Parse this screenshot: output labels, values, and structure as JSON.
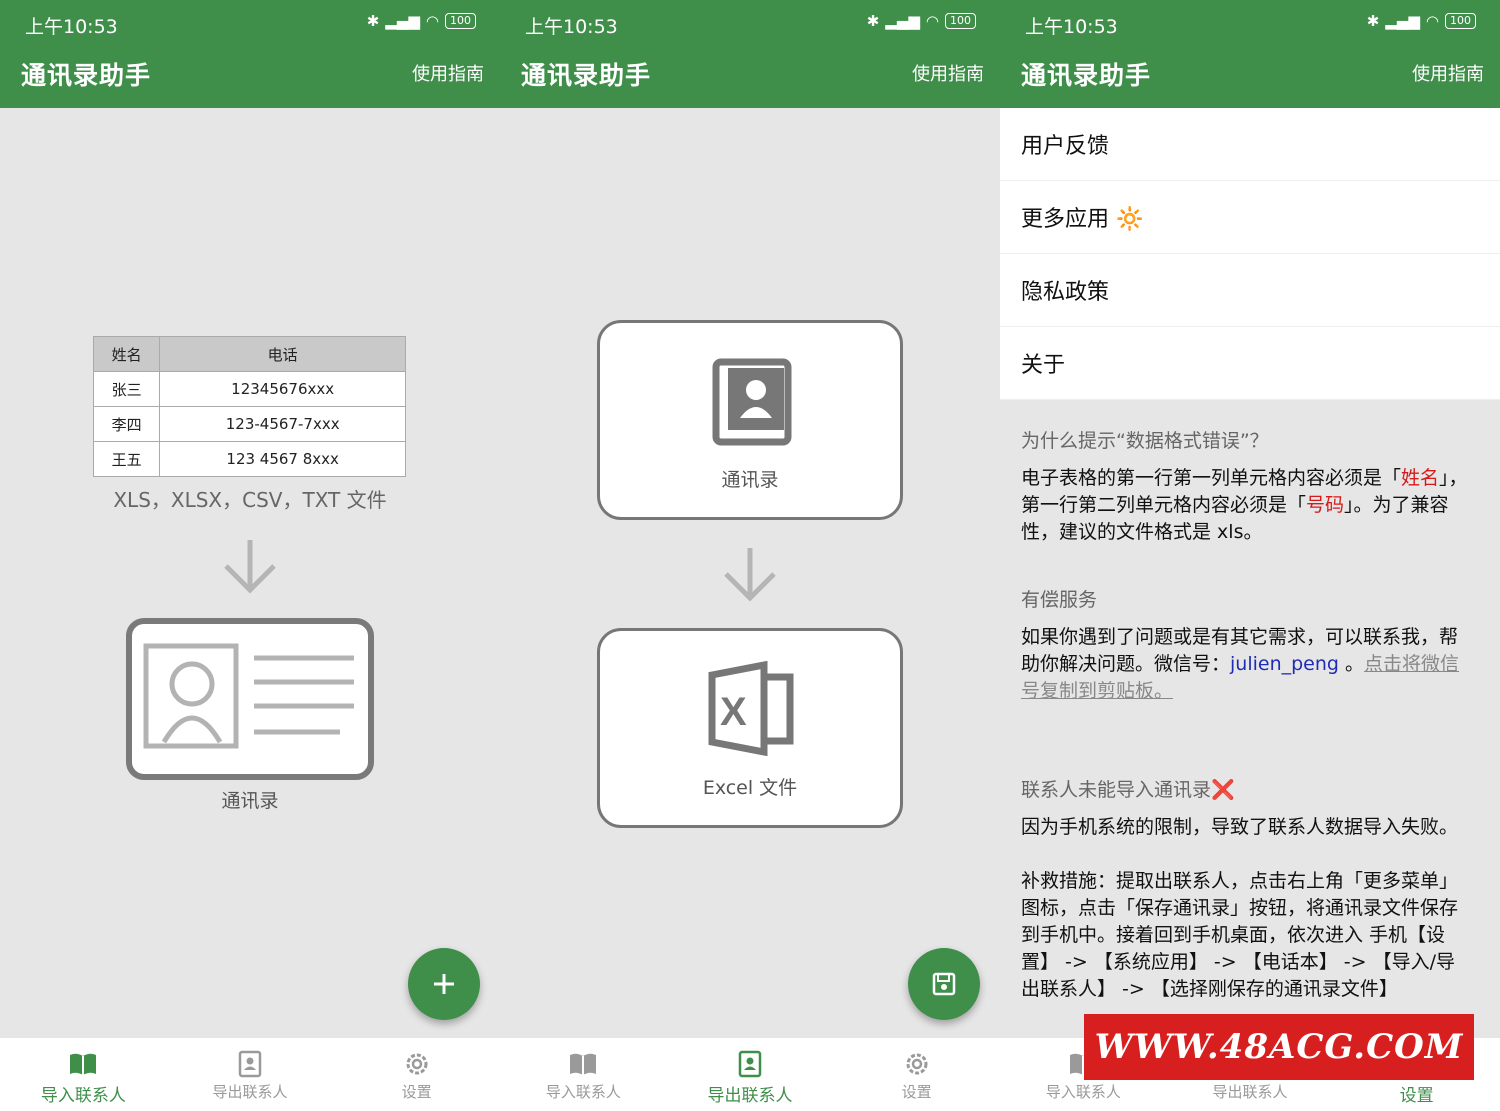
{
  "status": {
    "time": "上午10:53",
    "battery": "100"
  },
  "app": {
    "title": "通讯录助手",
    "guide": "使用指南"
  },
  "nav": {
    "import": "导入联系人",
    "export": "导出联系人",
    "settings": "设置"
  },
  "import_screen": {
    "table": {
      "headers": [
        "姓名",
        "电话"
      ],
      "rows": [
        [
          "张三",
          "12345676xxx"
        ],
        [
          "李四",
          "123-4567-7xxx"
        ],
        [
          "王五",
          "123 4567 8xxx"
        ]
      ]
    },
    "filetypes": "XLS，XLSX，CSV，TXT 文件",
    "card_caption": "通讯录",
    "fab_icon": "plus-icon"
  },
  "export_screen": {
    "contacts_caption": "通讯录",
    "excel_caption": "Excel 文件",
    "fab_icon": "save-icon"
  },
  "settings_screen": {
    "menu": [
      "用户反馈",
      "更多应用 🔆",
      "隐私政策",
      "关于"
    ],
    "faq1": {
      "title": "为什么提示“数据格式错误”？",
      "p1": "电子表格的第一行第一列单元格内容必须是「",
      "name_kw": "姓名",
      "p2": "」，第一行第二列单元格内容必须是「",
      "phone_kw": "号码",
      "p3": "」。为了兼容性，建议的文件格式是 xls。"
    },
    "faq2": {
      "title": "有偿服务",
      "p1": "如果你遇到了问题或是有其它需求，可以联系我，帮助你解决问题。微信号：",
      "wechat": "julien_peng",
      "p2": " 。",
      "link": "点击将微信号复制到剪贴板。"
    },
    "faq3": {
      "title": "联系人未能导入通讯录❌",
      "p1": "因为手机系统的限制，导致了联系人数据导入失败。",
      "p2": "补救措施：提取出联系人，点击右上角「更多菜单」图标，点击「保存通讯录」按钮，将通讯录文件保存到手机中。接着回到手机桌面，依次进入 手机【设置】 -> 【系统应用】 -> 【电话本】 -> 【导入/导出联系人】 -> 【选择刚保存的通讯录文件】"
    }
  },
  "watermark": "WWW.48ACG.COM",
  "colors": {
    "primary": "#3f8f4b",
    "red": "#d61a1a",
    "link_blue": "#1f2db5"
  }
}
